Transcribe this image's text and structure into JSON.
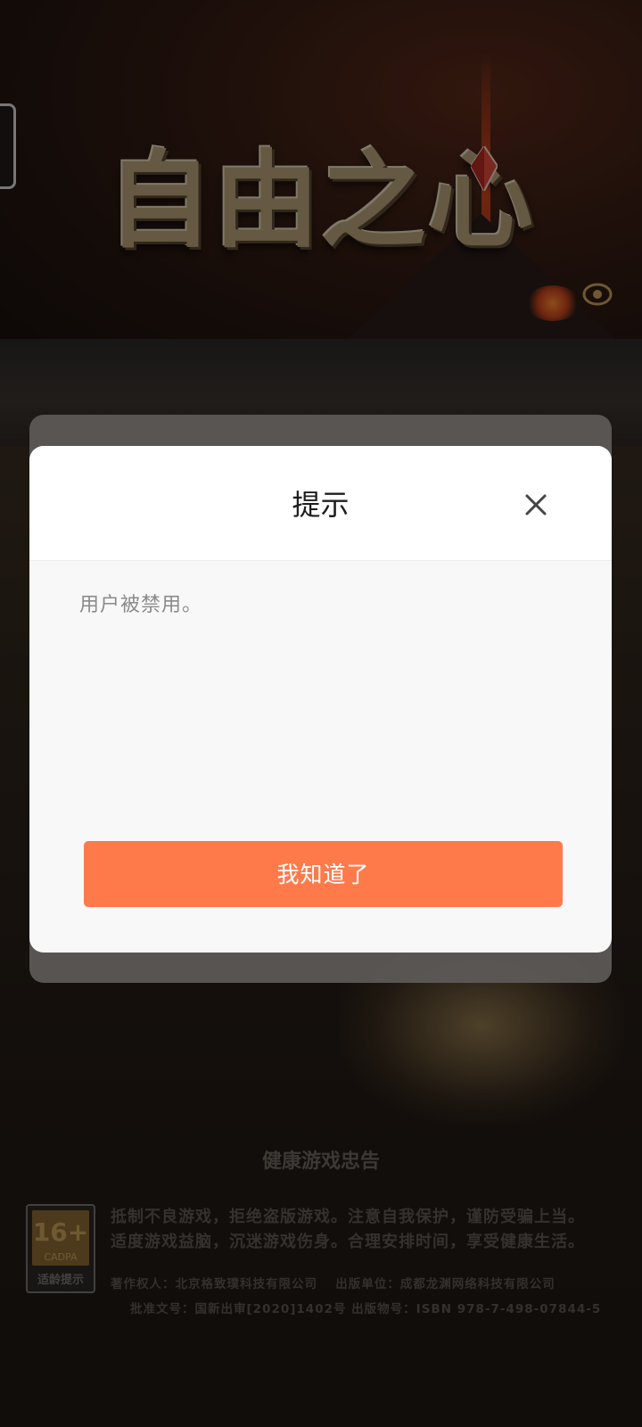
{
  "game": {
    "title": "自由之心"
  },
  "dialog": {
    "title": "提示",
    "message": "用户被禁用。",
    "confirm_label": "我知道了"
  },
  "health_notice": {
    "title": "健康游戏忠告",
    "line1": "抵制不良游戏，拒绝盗版游戏。注意自我保护，谨防受骗上当。",
    "line2": "适度游戏益脑，沉迷游戏伤身。合理安排时间，享受健康生活。",
    "credit1": "著作权人：北京格致璞科技有限公司　 出版单位：成都龙渊网络科技有限公司",
    "credit2": "批准文号：国新出审[2020]1402号 出版物号：ISBN 978-7-498-07844-5"
  },
  "age_rating": {
    "number": "16+",
    "org": "CADPA",
    "label": "适龄提示"
  },
  "colors": {
    "accent": "#ff7a4a",
    "dialog_bg": "#f8f8f8",
    "title_gold": "#b8a27a"
  }
}
